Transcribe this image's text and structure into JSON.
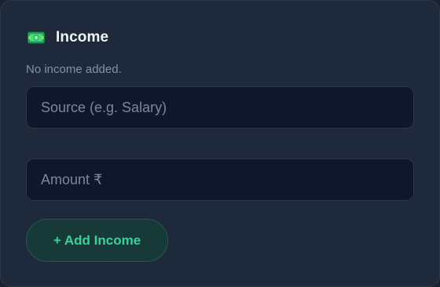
{
  "income_card": {
    "icon": "banknote-icon",
    "title": "Income",
    "empty_message": "No income added.",
    "source_placeholder": "Source (e.g. Salary)",
    "amount_placeholder": "Amount ₹",
    "add_button_label": "+ Add Income"
  },
  "colors": {
    "card_background": "#1e293b",
    "input_background": "#0f172a",
    "accent_green": "#34d399",
    "button_background": "#173a38"
  }
}
